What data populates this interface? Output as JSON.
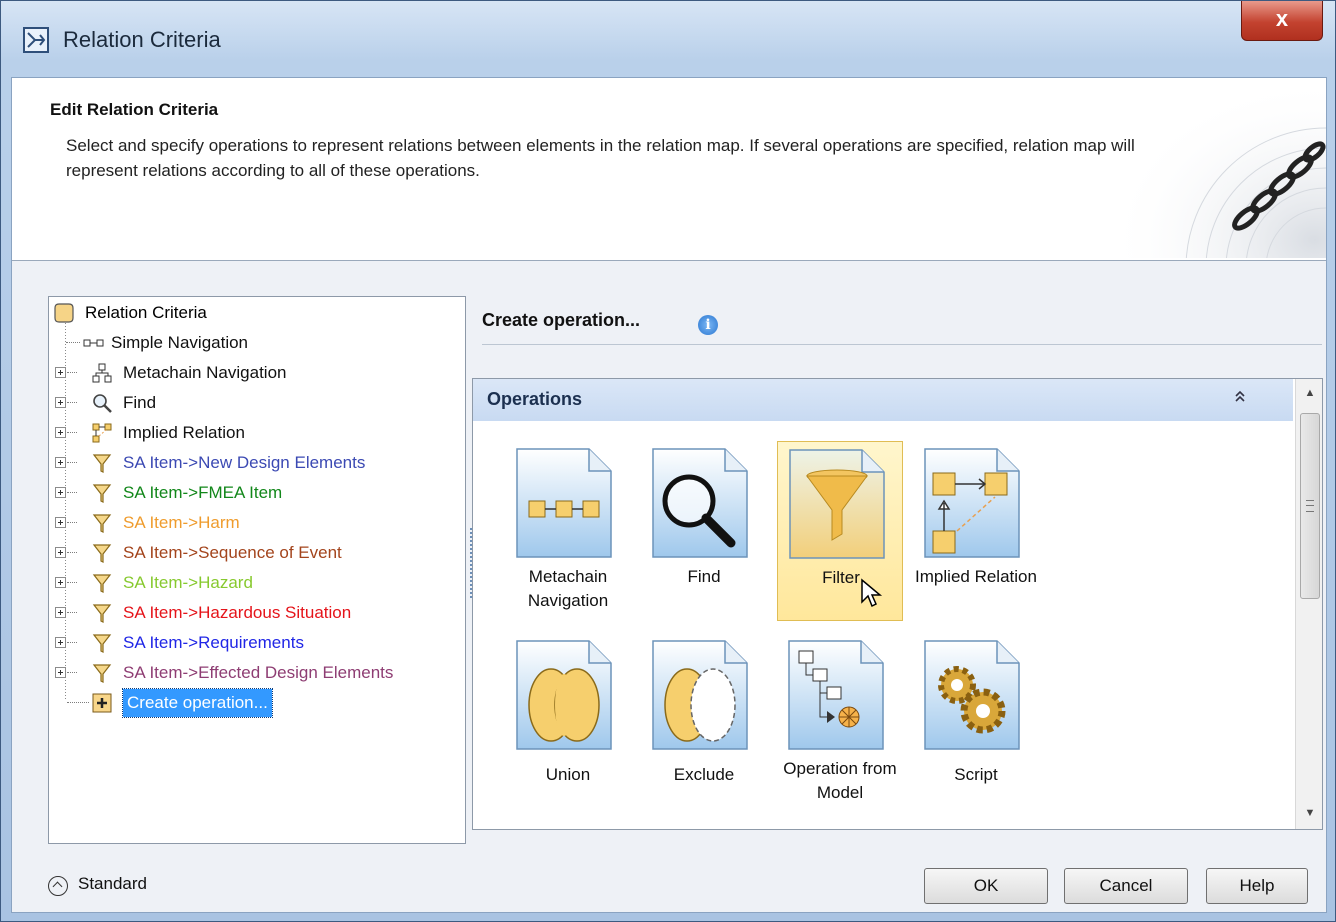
{
  "window": {
    "title": "Relation Criteria",
    "app_icon": "relation-map-icon",
    "close_label": "x"
  },
  "banner": {
    "title": "Edit Relation Criteria",
    "description": "Select and specify operations to represent relations between elements in the relation map. If several operations are specified, relation map will represent relations according to all of these operations.",
    "art_icon": "chain-icon"
  },
  "tree": {
    "root": {
      "label": "Relation Criteria",
      "icon": "relation-criteria-icon"
    },
    "items": [
      {
        "label": "Simple Navigation",
        "icon": "simple-navigation-icon",
        "color": "#111111",
        "expandable": false
      },
      {
        "label": "Metachain Navigation",
        "icon": "metachain-navigation-icon",
        "color": "#111111",
        "expandable": true
      },
      {
        "label": "Find",
        "icon": "find-icon",
        "color": "#111111",
        "expandable": true
      },
      {
        "label": "Implied Relation",
        "icon": "implied-relation-icon",
        "color": "#111111",
        "expandable": true
      },
      {
        "label": "SA Item->New Design Elements",
        "icon": "filter-icon",
        "color": "#3b49b3",
        "expandable": true
      },
      {
        "label": "SA Item->FMEA Item",
        "icon": "filter-icon",
        "color": "#12871a",
        "expandable": true
      },
      {
        "label": "SA Item->Harm",
        "icon": "filter-icon",
        "color": "#ef9c2d",
        "expandable": true
      },
      {
        "label": "SA Item->Sequence of Event",
        "icon": "filter-icon",
        "color": "#a3441c",
        "expandable": true
      },
      {
        "label": "SA Item->Hazard",
        "icon": "filter-icon",
        "color": "#87c92e",
        "expandable": true
      },
      {
        "label": "SA Item->Hazardous Situation",
        "icon": "filter-icon",
        "color": "#e5141a",
        "expandable": true
      },
      {
        "label": "SA Item->Requirements",
        "icon": "filter-icon",
        "color": "#2026e6",
        "expandable": true
      },
      {
        "label": "SA Item->Effected Design Elements",
        "icon": "filter-icon",
        "color": "#8e3d73",
        "expandable": true
      }
    ],
    "create": {
      "label": "Create operation...",
      "icon": "plus-icon"
    }
  },
  "right": {
    "heading": "Create operation...",
    "info_icon": "info-icon",
    "info_glyph": "i"
  },
  "operations": {
    "title": "Operations",
    "collapse_icon": "double-chevron-up-icon",
    "collapse_glyph": "⌃⌃",
    "scroll_up_glyph": "▲",
    "scroll_down_glyph": "▼",
    "tiles": [
      {
        "label": "Metachain Navigation",
        "icon": "metachain-navigation-icon",
        "selected": false
      },
      {
        "label": "Find",
        "icon": "magnifier-icon",
        "selected": false
      },
      {
        "label": "Filter",
        "icon": "funnel-icon",
        "selected": true
      },
      {
        "label": "Implied Relation",
        "icon": "implied-relation-icon",
        "selected": false
      },
      {
        "label": "Union",
        "icon": "union-icon",
        "selected": false
      },
      {
        "label": "Exclude",
        "icon": "exclude-icon",
        "selected": false
      },
      {
        "label": "Operation from Model",
        "icon": "operation-from-model-icon",
        "selected": false
      },
      {
        "label": "Script",
        "icon": "gears-icon",
        "selected": false
      }
    ]
  },
  "footer": {
    "mode_label": "Standard",
    "mode_icon": "chevron-up-circle-icon",
    "ok_label": "OK",
    "cancel_label": "Cancel",
    "help_label": "Help"
  }
}
